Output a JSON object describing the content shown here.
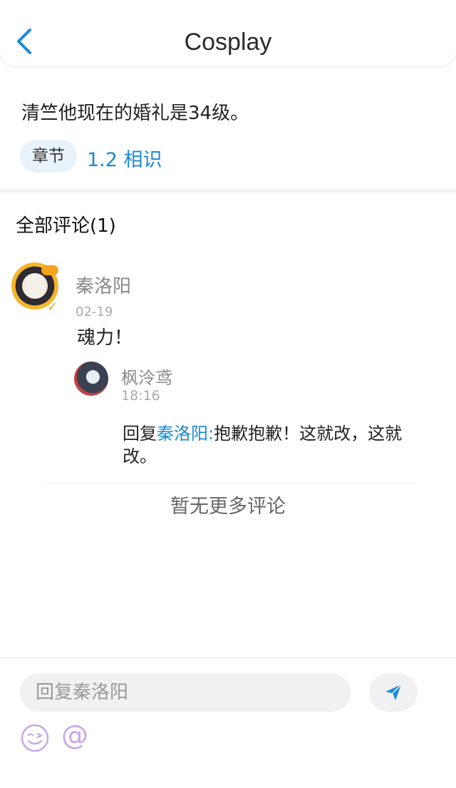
{
  "header": {
    "title": "Cosplay"
  },
  "post": {
    "quote": "清竺他现在的婚礼是34级。",
    "chapter_tag": "章节",
    "chapter_link": "1.2  相识"
  },
  "comments": {
    "title": "全部评论(1)",
    "items": [
      {
        "user": "秦洛阳",
        "date": "02-19",
        "content": "魂力！",
        "replies": [
          {
            "user": "枫泠鸢",
            "time": "18:16",
            "prefix": "回复",
            "mention": "秦洛阳:",
            "text": "抱歉抱歉！这就改，这就改。"
          }
        ]
      }
    ],
    "no_more": "暂无更多评论"
  },
  "composer": {
    "placeholder": "回复秦洛阳",
    "at_symbol": "@"
  },
  "colors": {
    "accent": "#1a8ad6",
    "emoji_purple": "#c9a5e8"
  },
  "icons": [
    "back-arrow-icon",
    "send-icon",
    "emoji-icon",
    "at-icon"
  ]
}
